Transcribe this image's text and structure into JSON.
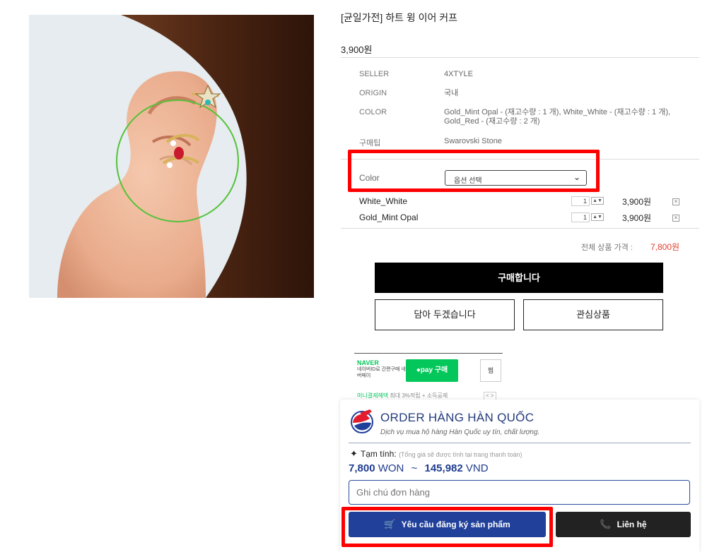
{
  "product": {
    "title": "[균일가전] 하트 윙 이어 커프",
    "price": "3,900원"
  },
  "specs": [
    {
      "label": "SELLER",
      "value": "4XTYLE"
    },
    {
      "label": "ORIGIN",
      "value": "국내"
    },
    {
      "label": "COLOR",
      "value": "Gold_Mint Opal - (재고수량 : 1 개), White_White - (재고수량 : 1 개), Gold_Red - (재고수량 : 2 개)"
    },
    {
      "label": "구매팁",
      "value": "Swarovski Stone"
    }
  ],
  "option": {
    "label": "Color",
    "select_value": "옵션 선택"
  },
  "selected_items": [
    {
      "name": "White_White",
      "qty": "1",
      "price": "3,900원"
    },
    {
      "name": "Gold_Mint Opal",
      "qty": "1",
      "price": "3,900원"
    }
  ],
  "total": {
    "label": "전체 상품 가격 :",
    "value": "7,800원"
  },
  "buttons": {
    "buy": "구매합니다",
    "cart": "담아 두겠습니다",
    "wish": "관심상품"
  },
  "naver_pay": {
    "brand": "NAVER",
    "sub": "네이버ID로 간편구매 네이버페이",
    "pay_label": "●pay 구매",
    "zzim": "찜",
    "promo_highlight": "머니결제혜택",
    "promo_rest": "최대 3%적립 + 소득공제",
    "pager": "< >"
  },
  "order_widget": {
    "title": "ORDER HÀNG HÀN QUỐC",
    "subtitle": "Dịch vụ mua hộ hàng Hàn Quốc uy tín, chất lượng.",
    "tam_tinh_label": "Tạm tính:",
    "tam_tinh_note": "(Tổng giá sẽ được tính tại trang thanh toán)",
    "won_amount": "7,800",
    "won_unit": "WON",
    "separator": "~",
    "vnd_amount": "145,982",
    "vnd_unit": "VND",
    "note_placeholder": "Ghi chú đơn hàng",
    "request_button": "Yêu cầu đăng ký sản phẩm",
    "contact_button": "Liên hệ"
  },
  "colors": {
    "highlight": "#ff0000",
    "order_blue": "#20409a",
    "naver_green": "#03c75a",
    "total_red": "#e23b2e"
  }
}
